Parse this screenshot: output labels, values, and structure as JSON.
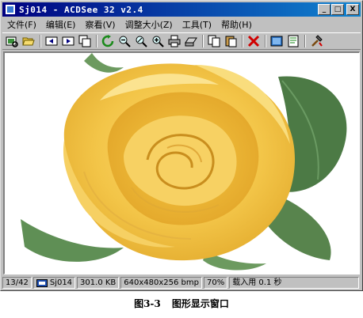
{
  "window": {
    "title": "Sj014 - ACDSee 32 v2.4",
    "controls": {
      "minimize": "_",
      "maximize": "□",
      "close": "X"
    }
  },
  "menu": [
    {
      "label": "文件(F)"
    },
    {
      "label": "编辑(E)"
    },
    {
      "label": "察看(V)"
    },
    {
      "label": "调整大小(Z)"
    },
    {
      "label": "工具(T)"
    },
    {
      "label": "帮助(H)"
    }
  ],
  "toolbar": {
    "icons": [
      "browse-icon",
      "open-folder-icon",
      "previous-icon",
      "next-icon",
      "copy-view-icon",
      "rotate-icon",
      "zoom-out-icon",
      "zoom-fit-icon",
      "zoom-in-icon",
      "print-icon",
      "scan-icon",
      "copy-icon",
      "paste-icon",
      "delete-icon",
      "slideshow-icon",
      "properties-icon",
      "tools-icon"
    ]
  },
  "image": {
    "subject": "yellow rose",
    "alt": "Sj014"
  },
  "status": {
    "position": "13/42",
    "filename": "Sj014",
    "filesize": "301.0 KB",
    "dimensions": "640x480x256 bmp",
    "zoom": "70%",
    "load_time": "载入用 0.1 秒"
  },
  "caption": "图3-3 图形显示窗口",
  "colors": {
    "title_bar": "#000080",
    "chrome": "#c0c0c0",
    "rose": "#f4c542"
  }
}
